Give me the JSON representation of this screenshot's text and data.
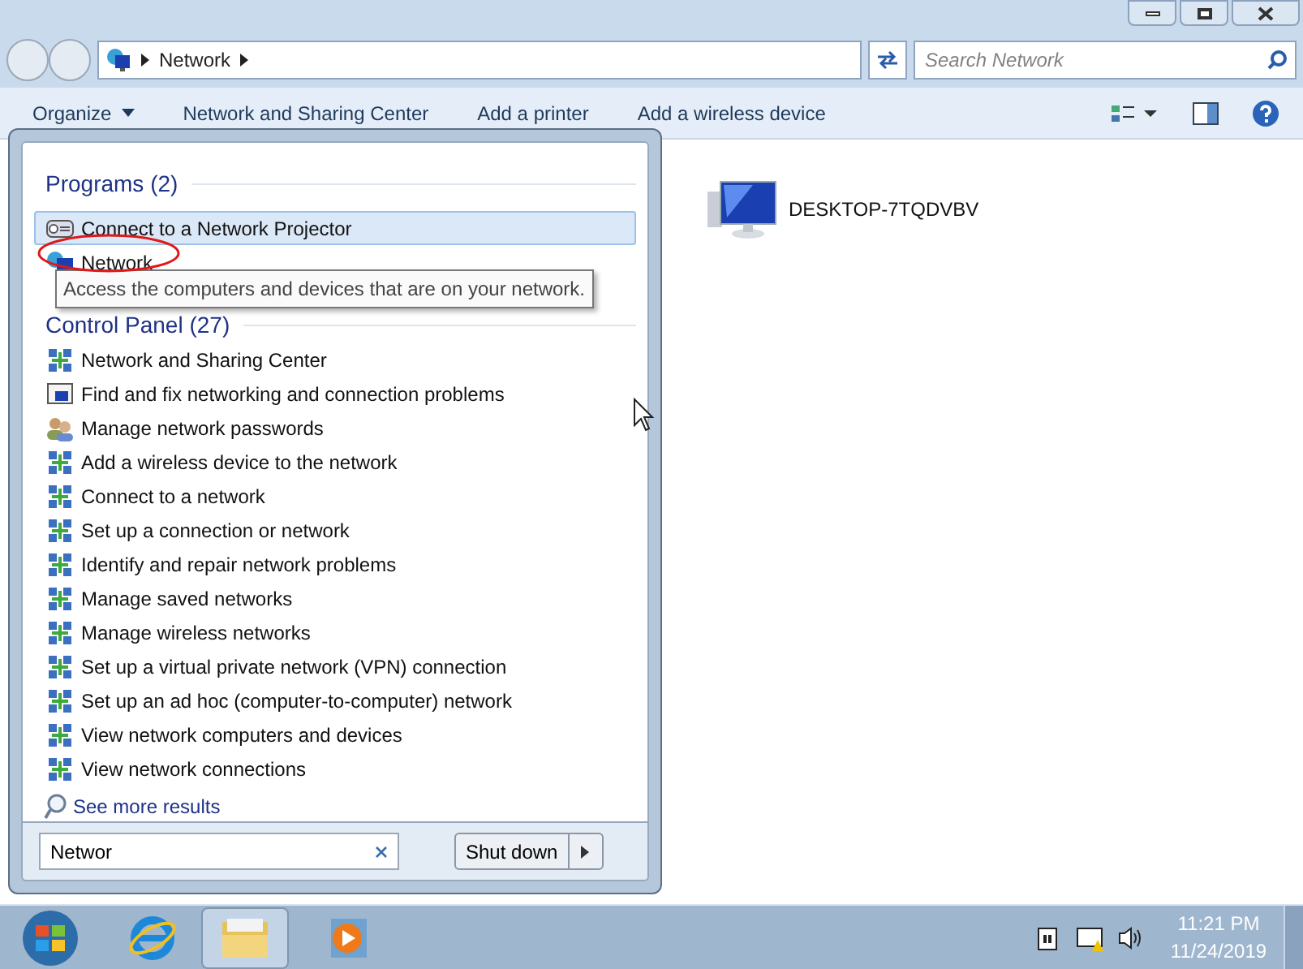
{
  "explorer": {
    "breadcrumb": [
      "Network"
    ],
    "search": {
      "placeholder": "Search Network"
    },
    "toolbar": [
      "Organize",
      "Network and Sharing Center",
      "Add a printer",
      "Add a wireless device"
    ],
    "items": [
      {
        "label": "DESKTOP-7TQDVBV"
      }
    ]
  },
  "start_menu": {
    "programs_heading": "Programs (2)",
    "programs": [
      {
        "label": "Connect to a Network Projector",
        "kind": "projector",
        "selected": true
      },
      {
        "label": "Network",
        "kind": "network",
        "selected": false
      }
    ],
    "tooltip": "Access the computers and devices that are on your network.",
    "control_panel_heading": "Control Panel (27)",
    "control_panel": [
      {
        "label": "Network and Sharing Center",
        "kind": "net"
      },
      {
        "label": "Find and fix networking and connection problems",
        "kind": "troubleshoot"
      },
      {
        "label": "Manage network passwords",
        "kind": "users"
      },
      {
        "label": "Add a wireless device to the network",
        "kind": "net"
      },
      {
        "label": "Connect to a network",
        "kind": "net"
      },
      {
        "label": "Set up a connection or network",
        "kind": "net"
      },
      {
        "label": "Identify and repair network problems",
        "kind": "net"
      },
      {
        "label": "Manage saved networks",
        "kind": "net"
      },
      {
        "label": "Manage wireless networks",
        "kind": "net"
      },
      {
        "label": "Set up a virtual private network (VPN) connection",
        "kind": "net"
      },
      {
        "label": "Set up an ad hoc (computer-to-computer) network",
        "kind": "net"
      },
      {
        "label": "View network computers and devices",
        "kind": "net"
      },
      {
        "label": "View network connections",
        "kind": "net"
      }
    ],
    "see_more": "See more results",
    "search_value": "Networ",
    "shutdown": "Shut down"
  },
  "taskbar": {
    "time": "11:21 PM",
    "date": "11/24/2019"
  }
}
